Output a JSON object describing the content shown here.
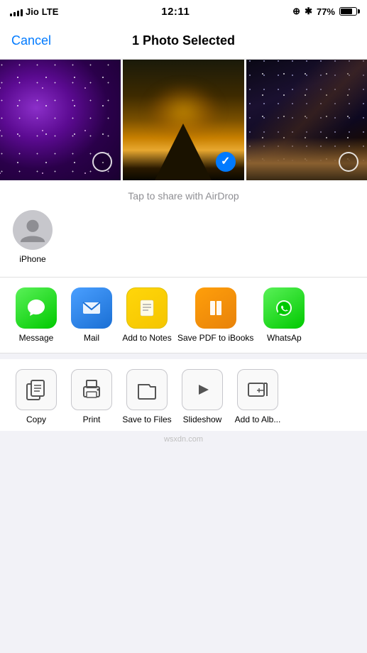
{
  "statusBar": {
    "carrier": "Jio",
    "network": "LTE",
    "time": "12:11",
    "battery": "77%"
  },
  "navBar": {
    "cancelLabel": "Cancel",
    "title": "1 Photo Selected"
  },
  "photos": [
    {
      "id": 1,
      "type": "galaxy",
      "selected": false
    },
    {
      "id": 2,
      "type": "mountain",
      "selected": true
    },
    {
      "id": 3,
      "type": "milkyway",
      "selected": false
    }
  ],
  "airdrop": {
    "hint": "Tap to share with AirDrop",
    "contacts": [
      {
        "name": "iPhone",
        "hasAvatar": false
      }
    ]
  },
  "shareApps": [
    {
      "id": "messages",
      "label": "Message",
      "colorClass": "app-messages",
      "icon": "💬"
    },
    {
      "id": "mail",
      "label": "Mail",
      "colorClass": "app-mail",
      "icon": "✉️"
    },
    {
      "id": "notes",
      "label": "Add to Notes",
      "colorClass": "app-notes",
      "icon": "📝"
    },
    {
      "id": "ibooks",
      "label": "Save PDF to iBooks",
      "colorClass": "app-ibooks",
      "icon": "📖"
    },
    {
      "id": "whatsapp",
      "label": "WhatsAp",
      "colorClass": "app-whatsapp",
      "icon": "📱"
    }
  ],
  "bottomActions": [
    {
      "id": "copy",
      "label": "Copy"
    },
    {
      "id": "print",
      "label": "Print"
    },
    {
      "id": "save-files",
      "label": "Save to Files"
    },
    {
      "id": "slideshow",
      "label": "Slideshow"
    },
    {
      "id": "add-album",
      "label": "Add to Alb..."
    }
  ],
  "watermark": "wsxdn.com"
}
